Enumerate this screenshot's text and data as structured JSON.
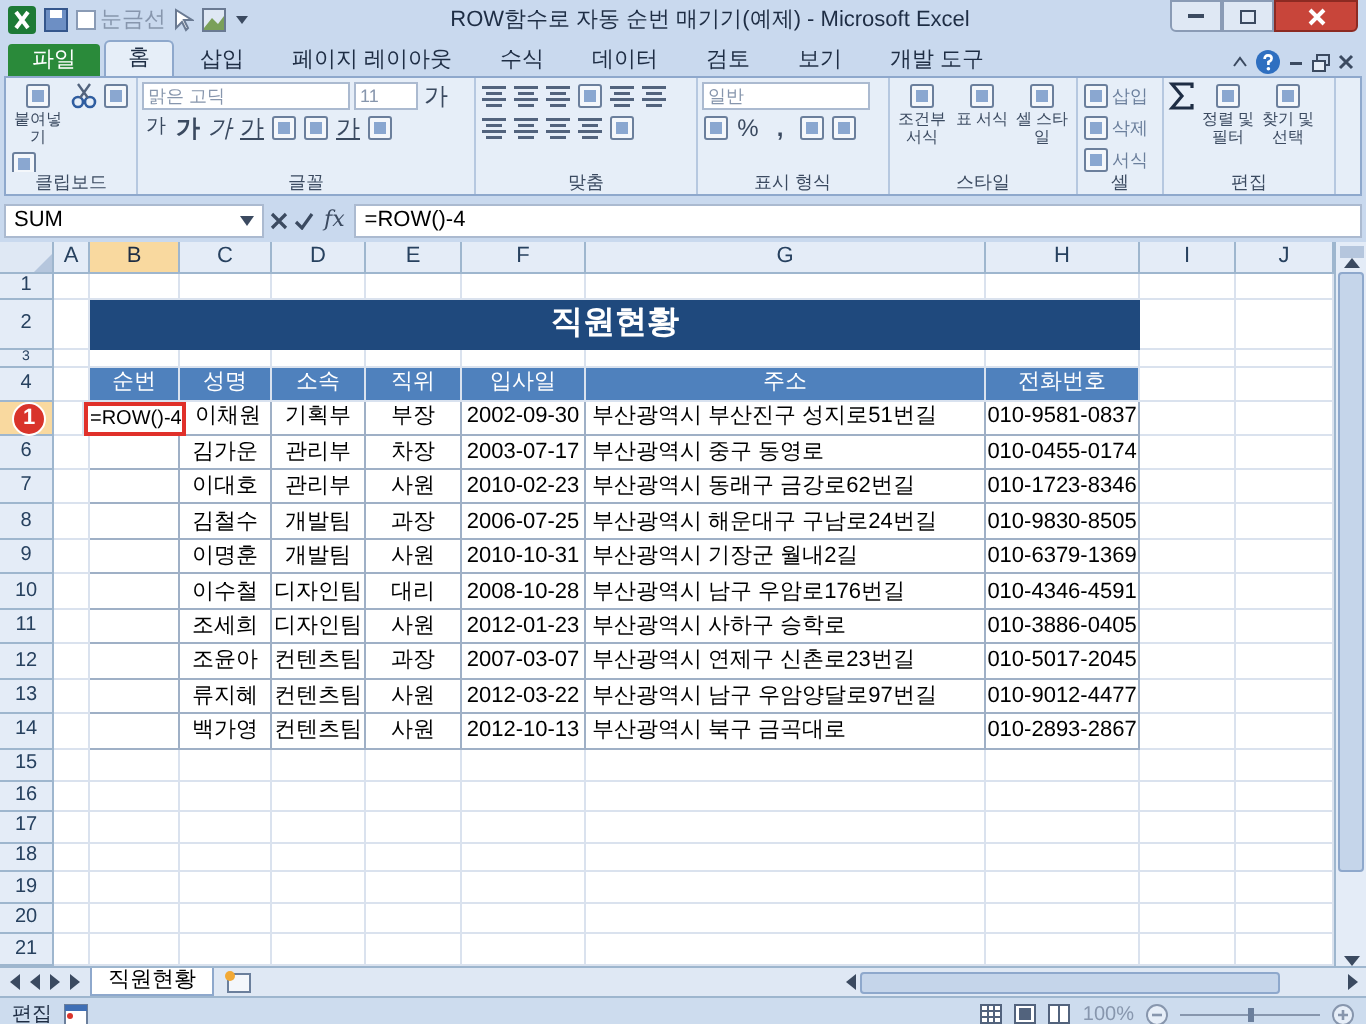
{
  "window": {
    "title": "ROW함수로 자동 순번 매기기(예제) - Microsoft Excel"
  },
  "quick_access": [
    {
      "label": "눈금선",
      "checked": false
    }
  ],
  "ribbon_tabs": [
    {
      "label": "파일",
      "kind": "file",
      "selected": false
    },
    {
      "label": "홈",
      "kind": "tab",
      "selected": true
    },
    {
      "label": "삽입",
      "kind": "tab",
      "selected": false
    },
    {
      "label": "페이지 레이아웃",
      "kind": "tab",
      "selected": false
    },
    {
      "label": "수식",
      "kind": "tab",
      "selected": false
    },
    {
      "label": "데이터",
      "kind": "tab",
      "selected": false
    },
    {
      "label": "검토",
      "kind": "tab",
      "selected": false
    },
    {
      "label": "보기",
      "kind": "tab",
      "selected": false
    },
    {
      "label": "개발 도구",
      "kind": "tab",
      "selected": false
    }
  ],
  "ribbon_groups": [
    {
      "label": "클립보드",
      "items": [
        {
          "kind": "large",
          "label": "붙여넣기"
        },
        {
          "kind": "icon"
        },
        {
          "kind": "icon"
        },
        {
          "kind": "icon"
        }
      ]
    },
    {
      "label": "글꼴",
      "items": [
        {
          "kind": "field",
          "value": "맑은 고딕"
        },
        {
          "kind": "field",
          "value": "11"
        },
        {
          "kind": "glyph",
          "label": "가"
        },
        {
          "kind": "glyph",
          "label": "가"
        },
        {
          "kind": "glyph",
          "label": "가"
        },
        {
          "kind": "glyph",
          "label": "가"
        },
        {
          "kind": "glyph",
          "label": "가"
        },
        {
          "kind": "icon"
        },
        {
          "kind": "icon"
        },
        {
          "kind": "glyph",
          "label": "가"
        },
        {
          "kind": "icon"
        }
      ]
    },
    {
      "label": "맞춤",
      "items": [
        {
          "kind": "icon"
        },
        {
          "kind": "icon"
        },
        {
          "kind": "icon"
        },
        {
          "kind": "icon"
        },
        {
          "kind": "icon"
        },
        {
          "kind": "icon"
        },
        {
          "kind": "icon"
        },
        {
          "kind": "icon"
        },
        {
          "kind": "icon"
        },
        {
          "kind": "icon"
        },
        {
          "kind": "icon"
        }
      ]
    },
    {
      "label": "표시 형식",
      "items": [
        {
          "kind": "field",
          "value": "일반"
        },
        {
          "kind": "icon"
        },
        {
          "kind": "glyph",
          "label": "%"
        },
        {
          "kind": "glyph",
          "label": ","
        },
        {
          "kind": "icon"
        },
        {
          "kind": "icon"
        }
      ]
    },
    {
      "label": "스타일",
      "items": [
        {
          "kind": "large",
          "label": "조건부 서식"
        },
        {
          "kind": "large",
          "label": "표 서식"
        },
        {
          "kind": "large",
          "label": "셀 스타일"
        }
      ]
    },
    {
      "label": "셀",
      "items": [
        {
          "kind": "small",
          "label": "삽입"
        },
        {
          "kind": "small",
          "label": "삭제"
        },
        {
          "kind": "small",
          "label": "서식"
        }
      ]
    },
    {
      "label": "편집",
      "items": [
        {
          "kind": "icon"
        },
        {
          "kind": "large",
          "label": "정렬 및 필터"
        },
        {
          "kind": "large",
          "label": "찾기 및 선택"
        }
      ]
    }
  ],
  "formula_bar": {
    "name_box": "SUM",
    "function_button": "fx",
    "formula": "=ROW()-4"
  },
  "sheet": {
    "columns": [
      {
        "label": "A",
        "selected": false
      },
      {
        "label": "B",
        "selected": true
      },
      {
        "label": "C",
        "selected": false
      },
      {
        "label": "D",
        "selected": false
      },
      {
        "label": "E",
        "selected": false
      },
      {
        "label": "F",
        "selected": false
      },
      {
        "label": "G",
        "selected": false
      },
      {
        "label": "H",
        "selected": false
      },
      {
        "label": "I",
        "selected": false
      },
      {
        "label": "J",
        "selected": false
      }
    ],
    "row_numbers": [
      {
        "label": "1",
        "selected": false
      },
      {
        "label": "2",
        "selected": false
      },
      {
        "label": "3",
        "selected": false
      },
      {
        "label": "4",
        "selected": false
      },
      {
        "selected": true
      },
      {
        "label": "6",
        "selected": false
      },
      {
        "label": "7",
        "selected": false
      },
      {
        "label": "8",
        "selected": false
      },
      {
        "label": "9",
        "selected": false
      },
      {
        "label": "10",
        "selected": false
      },
      {
        "label": "11",
        "selected": false
      },
      {
        "label": "12",
        "selected": false
      },
      {
        "label": "13",
        "selected": false
      },
      {
        "label": "14",
        "selected": false
      },
      {
        "label": "15",
        "selected": false
      },
      {
        "label": "16",
        "selected": false
      },
      {
        "label": "17",
        "selected": false
      },
      {
        "label": "18",
        "selected": false
      },
      {
        "label": "19",
        "selected": false
      },
      {
        "label": "20",
        "selected": false
      },
      {
        "label": "21",
        "selected": false
      }
    ],
    "title": "직원현황",
    "table": {
      "columns": [
        "순번",
        "성명",
        "소속",
        "직위",
        "입사일",
        "주소",
        "전화번호"
      ],
      "rows": [
        {
          "active": true,
          "cells": [
            "=ROW()-4",
            "이채원",
            "기획부",
            "부장",
            "2002-09-30",
            "부산광역시 부산진구 성지로51번길",
            "010-9581-0837"
          ]
        },
        {
          "active": false,
          "cells": [
            "",
            "김가운",
            "관리부",
            "차장",
            "2003-07-17",
            "부산광역시 중구 동영로",
            "010-0455-0174"
          ]
        },
        {
          "active": false,
          "cells": [
            "",
            "이대호",
            "관리부",
            "사원",
            "2010-02-23",
            "부산광역시 동래구 금강로62번길",
            "010-1723-8346"
          ]
        },
        {
          "active": false,
          "cells": [
            "",
            "김철수",
            "개발팀",
            "과장",
            "2006-07-25",
            "부산광역시 해운대구 구남로24번길",
            "010-9830-8505"
          ]
        },
        {
          "active": false,
          "cells": [
            "",
            "이명훈",
            "개발팀",
            "사원",
            "2010-10-31",
            "부산광역시 기장군 월내2길",
            "010-6379-1369"
          ]
        },
        {
          "active": false,
          "cells": [
            "",
            "이수철",
            "디자인팀",
            "대리",
            "2008-10-28",
            "부산광역시 남구 우암로176번길",
            "010-4346-4591"
          ]
        },
        {
          "active": false,
          "cells": [
            "",
            "조세희",
            "디자인팀",
            "사원",
            "2012-01-23",
            "부산광역시 사하구 승학로",
            "010-3886-0405"
          ]
        },
        {
          "active": false,
          "cells": [
            "",
            "조윤아",
            "컨텐츠팀",
            "과장",
            "2007-03-07",
            "부산광역시 연제구 신촌로23번길",
            "010-5017-2045"
          ]
        },
        {
          "active": false,
          "cells": [
            "",
            "류지혜",
            "컨텐츠팀",
            "사원",
            "2012-03-22",
            "부산광역시 남구 우암양달로97번길",
            "010-9012-4477"
          ]
        },
        {
          "active": false,
          "cells": [
            "",
            "백가영",
            "컨텐츠팀",
            "사원",
            "2012-10-13",
            "부산광역시 북구 금곡대로",
            "010-2893-2867"
          ]
        }
      ]
    },
    "callout": {
      "label": "1"
    }
  },
  "sheet_tabs": [
    {
      "label": "직원현황",
      "selected": true
    }
  ],
  "status_bar": {
    "mode": "편집",
    "zoom": "100%",
    "zoom_slider": {
      "level": 0.5
    }
  }
}
